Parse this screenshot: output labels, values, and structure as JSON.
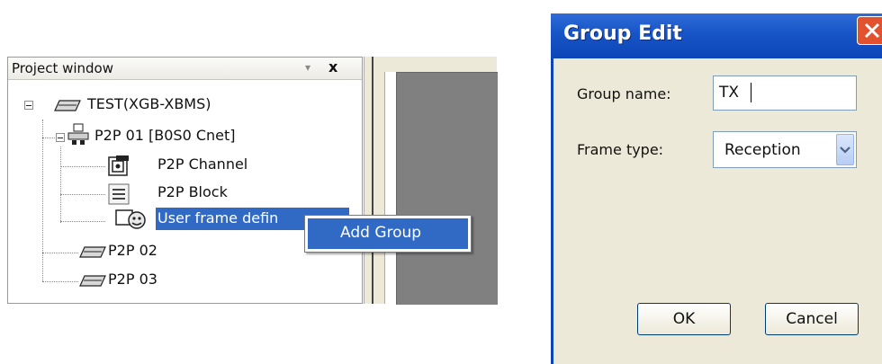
{
  "project_window": {
    "title": "Project window",
    "pin_glyph": "▾",
    "close_glyph": "x",
    "tree": {
      "root": "TEST(XGB-XBMS)",
      "p2p01": "P2P 01 [B0S0 Cnet]",
      "channel": "P2P Channel",
      "block": "P2P Block",
      "user_frame": "User frame defin",
      "p2p02": "P2P 02",
      "p2p03": "P2P 03"
    }
  },
  "context_menu": {
    "items": [
      "Add Group"
    ]
  },
  "dialog": {
    "title": "Group Edit",
    "group_name_label": "Group name:",
    "group_name_value": "TX",
    "frame_type_label": "Frame type:",
    "frame_type_value": "Reception",
    "ok_label": "OK",
    "cancel_label": "Cancel"
  },
  "colors": {
    "selection": "#316ac5",
    "titlebar": "#1956c8",
    "dialog_bg": "#ece9d8",
    "close_button": "#e3522f"
  },
  "icons": [
    "minus-expander-icon",
    "plc-icon",
    "network-icon",
    "channel-icon",
    "block-icon",
    "user-frame-icon",
    "chevron-down-icon",
    "close-icon"
  ]
}
